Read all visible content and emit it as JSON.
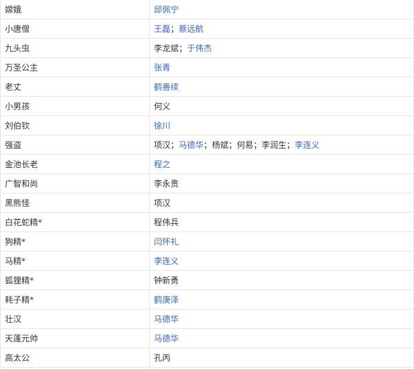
{
  "rows": [
    {
      "role": "嫦娥",
      "actors": [
        {
          "name": "邱佩宁",
          "link": true
        }
      ]
    },
    {
      "role": "小唐僧",
      "actors": [
        {
          "name": "王磊",
          "link": true
        },
        {
          "name": "蔡远航",
          "link": true
        }
      ]
    },
    {
      "role": "九头虫",
      "actors": [
        {
          "name": "李龙斌",
          "link": false
        },
        {
          "name": "于伟杰",
          "link": true
        }
      ]
    },
    {
      "role": "万圣公主",
      "actors": [
        {
          "name": "张青",
          "link": true
        }
      ]
    },
    {
      "role": "老丈",
      "actors": [
        {
          "name": "鹤善续",
          "link": true
        }
      ]
    },
    {
      "role": "小男孩",
      "actors": [
        {
          "name": "何义",
          "link": false
        }
      ]
    },
    {
      "role": "刘伯钦",
      "actors": [
        {
          "name": "徐川",
          "link": true
        }
      ]
    },
    {
      "role": "强盗",
      "actors": [
        {
          "name": "项汉",
          "link": false
        },
        {
          "name": "马德华",
          "link": true
        },
        {
          "name": "杨斌",
          "link": false
        },
        {
          "name": "何易",
          "link": false
        },
        {
          "name": "李润生",
          "link": false
        },
        {
          "name": "李连义",
          "link": true
        }
      ]
    },
    {
      "role": "金池长老",
      "actors": [
        {
          "name": "程之",
          "link": true
        }
      ]
    },
    {
      "role": "广智和尚",
      "actors": [
        {
          "name": "李永贵",
          "link": false
        }
      ]
    },
    {
      "role": "黑熊怪",
      "actors": [
        {
          "name": "项汉",
          "link": false
        }
      ]
    },
    {
      "role": "白花蛇精*",
      "actors": [
        {
          "name": "程伟兵",
          "link": false
        }
      ]
    },
    {
      "role": "狗精*",
      "actors": [
        {
          "name": "闫怀礼",
          "link": true
        }
      ]
    },
    {
      "role": "马精*",
      "actors": [
        {
          "name": "李连义",
          "link": true
        }
      ]
    },
    {
      "role": "狐狸精*",
      "actors": [
        {
          "name": "钟新勇",
          "link": false
        }
      ]
    },
    {
      "role": "耗子精*",
      "actors": [
        {
          "name": "鹤庚泽",
          "link": true
        }
      ]
    },
    {
      "role": "壮汉",
      "actors": [
        {
          "name": "马德华",
          "link": true
        }
      ]
    },
    {
      "role": "天蓬元帅",
      "actors": [
        {
          "name": "马德华",
          "link": true
        }
      ]
    },
    {
      "role": "高太公",
      "actors": [
        {
          "name": "孔丙",
          "link": false
        }
      ]
    }
  ],
  "separator": "；"
}
